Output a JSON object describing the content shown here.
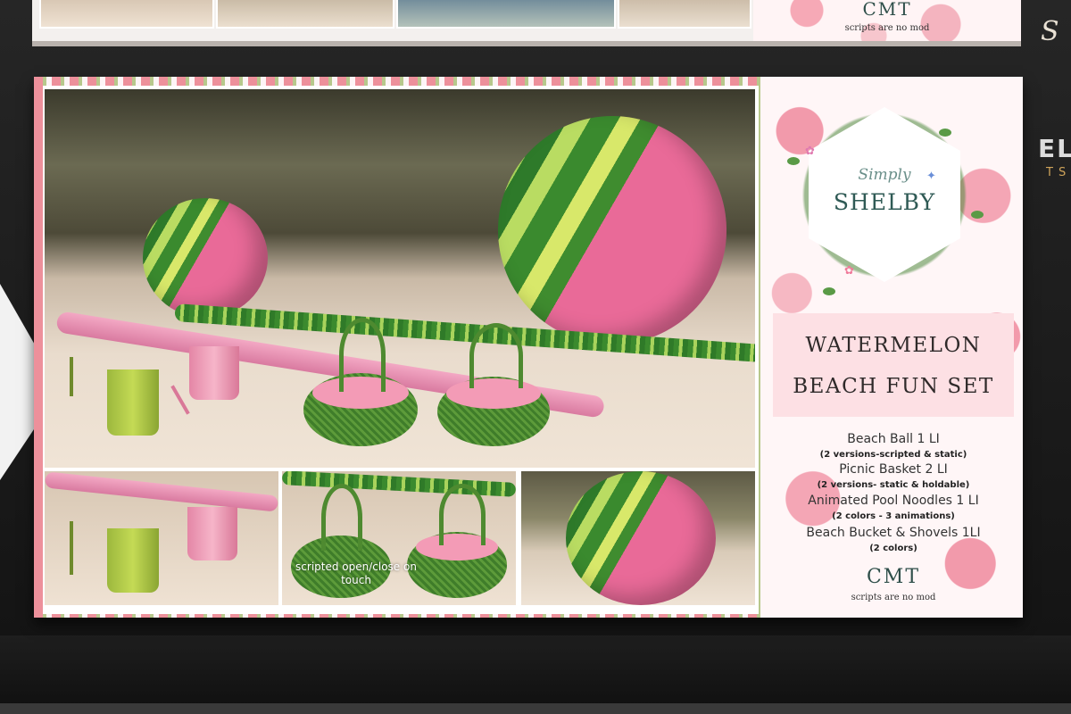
{
  "top_board": {
    "cmt": "CMT",
    "note": "scripts are no mod"
  },
  "photo": {
    "caption": "scripted open/close on touch"
  },
  "brand": {
    "script": "Simply",
    "name": "SHELBY"
  },
  "product": {
    "title_line1": "WATERMELON",
    "title_line2": "BEACH FUN SET"
  },
  "items": [
    {
      "name": "Beach Ball 1 LI",
      "note": "(2 versions-scripted & static)"
    },
    {
      "name": "Picnic Basket 2 LI",
      "note": "(2 versions- static & holdable)"
    },
    {
      "name": "Animated Pool Noodles 1 LI",
      "note": "(2 colors - 3 animations)"
    },
    {
      "name": "Beach Bucket & Shovels 1LI",
      "note": "(2 colors)"
    }
  ],
  "footer": {
    "cmt": "CMT",
    "note": "scripts are no mod"
  },
  "side_fragment": {
    "letters": "EL",
    "sub": "TS"
  },
  "colors": {
    "melon_pink": "#e96a98",
    "melon_green": "#3b8a2e",
    "panel_pink": "#fde0e4"
  }
}
